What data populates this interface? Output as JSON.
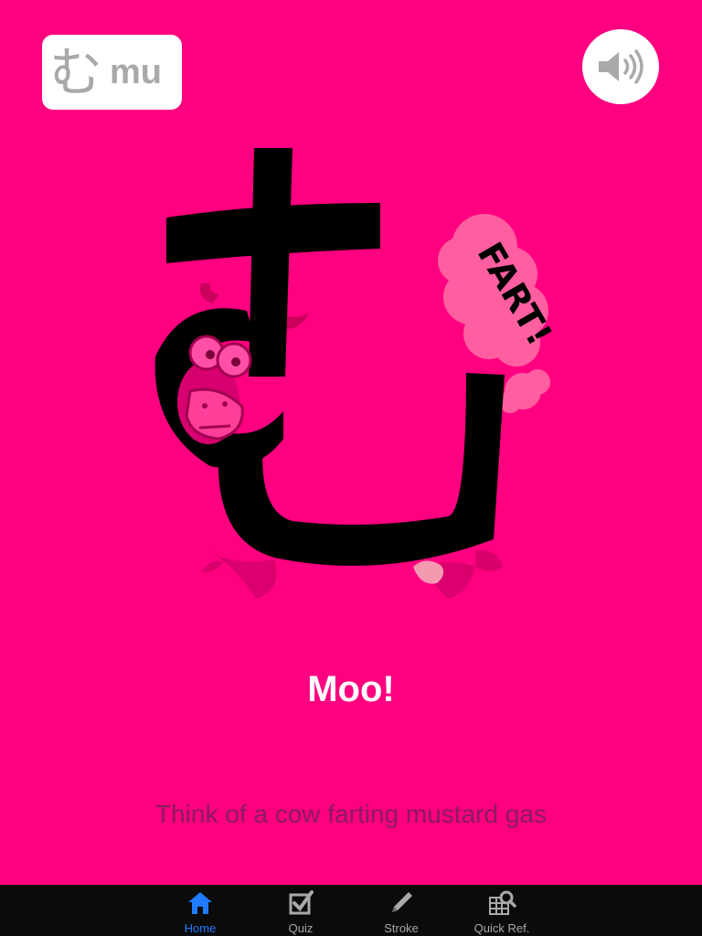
{
  "header": {
    "kana": "む",
    "romaji": "mu"
  },
  "sound_button": {
    "icon": "speaker-icon"
  },
  "illustration": {
    "speech_bubble_text": "FART!",
    "description_icon": "cow-mu-character-icon"
  },
  "caption": "Moo!",
  "hint": "Think of a cow farting mustard gas",
  "tabbar": {
    "tabs": [
      {
        "label": "Home",
        "icon": "home-icon",
        "active": true
      },
      {
        "label": "Quiz",
        "icon": "checkbox-icon",
        "active": false
      },
      {
        "label": "Stroke",
        "icon": "pencil-icon",
        "active": false
      },
      {
        "label": "Quick Ref.",
        "icon": "grid-search-icon",
        "active": false
      }
    ]
  },
  "colors": {
    "background": "#ff0080",
    "active_tab": "#1f7cff",
    "tabbar": "#0b0b0b"
  }
}
